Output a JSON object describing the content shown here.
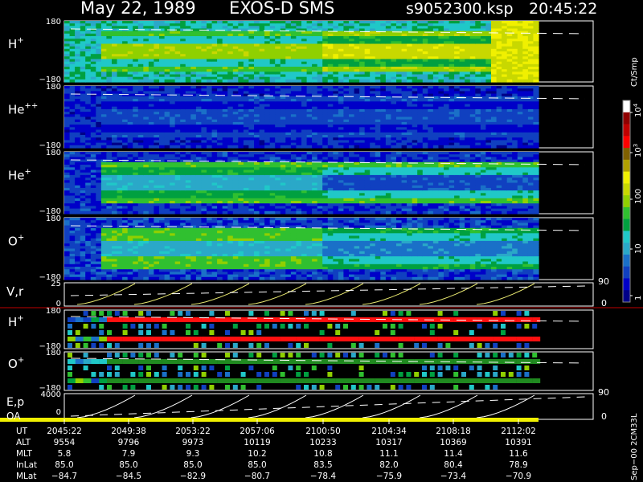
{
  "header": {
    "date": "May 22, 1989",
    "instrument": "EXOS-D SMS",
    "file": "s9052300.ksp",
    "time": "20:45:22"
  },
  "chart_data": {
    "type": "heatmap",
    "panels": [
      {
        "name": "H+",
        "label": "H",
        "sup": "+",
        "ymax": "180",
        "ymin": "−180",
        "base": 4.0,
        "band_levels": [
          5,
          7,
          5,
          8
        ],
        "band_after": [
          6,
          8,
          6,
          9
        ]
      },
      {
        "name": "He++",
        "label": "He",
        "sup": "++",
        "ymax": "180",
        "ymin": "−180",
        "base": 0.3,
        "band_levels": [
          1,
          2,
          1,
          2
        ],
        "band_after": [
          1,
          2,
          1,
          2
        ]
      },
      {
        "name": "He+",
        "label": "He",
        "sup": "+",
        "ymax": "180",
        "ymin": "−180",
        "base": 0.5,
        "band_levels": [
          4,
          7,
          6,
          4
        ],
        "band_after": [
          2,
          7,
          5,
          2
        ]
      },
      {
        "name": "O+",
        "label": "O",
        "sup": "+",
        "ymax": "180",
        "ymin": "−180",
        "base": 0.8,
        "band_levels": [
          4,
          7,
          7,
          4
        ],
        "band_after": [
          3,
          6,
          5,
          3
        ]
      }
    ],
    "vr_panel": {
      "label": "V,r",
      "ymax": "25",
      "ymin": "0",
      "right_top": "90",
      "right_bottom": "0"
    },
    "h_pitch_panel": {
      "label": "H",
      "sup": "+",
      "ymax": "180",
      "ymin": "−180"
    },
    "o_pitch_panel": {
      "label": "O",
      "sup": "+",
      "ymax": "180",
      "ymin": "−180"
    },
    "ep_panel": {
      "label": "E,p",
      "sub": "OA",
      "ymax": "4000",
      "ymin": "0",
      "right_top": "90",
      "right_bottom": "0"
    },
    "colorbar": {
      "unit": "Ct/Smp",
      "tick_labels": [
        "1",
        "10",
        "100",
        "10",
        "10"
      ],
      "tick_sups": [
        "",
        "",
        "",
        "3",
        "4"
      ],
      "colors": [
        "#000088",
        "#0000c8",
        "#1040c0",
        "#1a70c8",
        "#2aa8c8",
        "#20c8c8",
        "#00a040",
        "#30c030",
        "#90d000",
        "#c8d800",
        "#f0f000",
        "#b0a000",
        "#806000",
        "#ff0000",
        "#c00000",
        "#900000",
        "#ffffff"
      ]
    },
    "time_table": {
      "row_labels": [
        "UT",
        "ALT",
        "MLT",
        "InLat",
        "MLat"
      ],
      "rows": [
        [
          "2045:22",
          "2049:38",
          "2053:22",
          "2057:06",
          "2100:50",
          "2104:34",
          "2108:18",
          "2112:02"
        ],
        [
          "9554",
          "9796",
          "9973",
          "10119",
          "10233",
          "10317",
          "10369",
          "10391"
        ],
        [
          "5.8",
          "7.9",
          "9.3",
          "10.2",
          "10.8",
          "11.1",
          "11.4",
          "11.6"
        ],
        [
          "85.0",
          "85.0",
          "85.0",
          "85.0",
          "83.5",
          "82.0",
          "80.4",
          "78.9"
        ],
        [
          "−84.7",
          "−84.5",
          "−82.9",
          "−80.7",
          "−78.4",
          "−75.9",
          "−73.4",
          "−70.9"
        ]
      ]
    },
    "footer_note": "Sep−00 2CM33L"
  }
}
